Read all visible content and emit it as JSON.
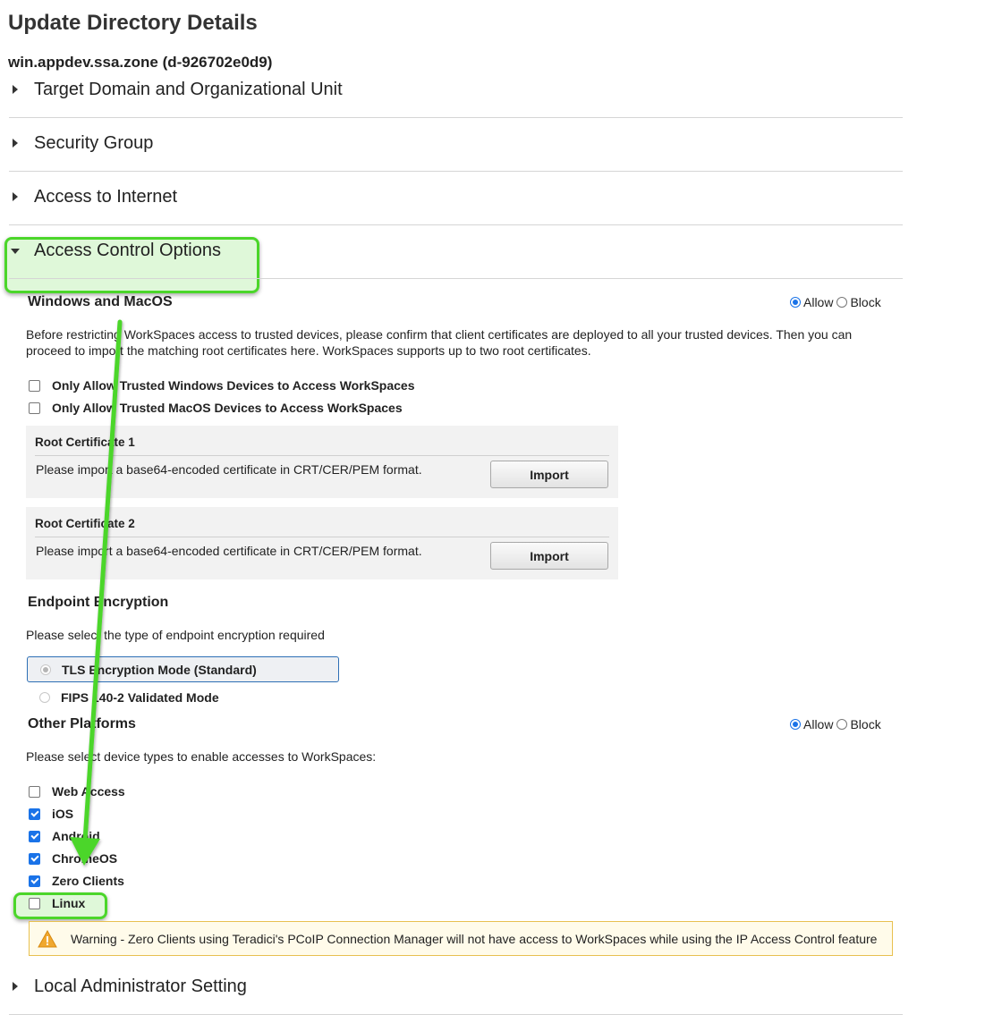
{
  "page_title": "Update Directory Details",
  "directory_id": "win.appdev.ssa.zone (d-926702e0d9)",
  "sections": [
    {
      "label": "Target Domain and Organizational Unit",
      "expanded": false
    },
    {
      "label": "Security Group",
      "expanded": false
    },
    {
      "label": "Access to Internet",
      "expanded": false
    },
    {
      "label": "Access Control Options",
      "expanded": true
    },
    {
      "label": "Local Administrator Setting",
      "expanded": false
    }
  ],
  "windows_macos": {
    "heading": "Windows and MacOS",
    "allow_label": "Allow",
    "block_label": "Block",
    "selected": "Allow",
    "description": "Before restricting WorkSpaces access to trusted devices, please confirm that client certificates are deployed to all your trusted devices. Then you can proceed to import the matching root certificates here. WorkSpaces supports up to two root certificates.",
    "options": [
      {
        "label": "Only Allow Trusted Windows Devices to Access WorkSpaces",
        "checked": false
      },
      {
        "label": "Only Allow Trusted MacOS Devices to Access WorkSpaces",
        "checked": false
      }
    ],
    "certificates": [
      {
        "title": "Root Certificate 1",
        "description": "Please import a base64-encoded certificate in CRT/CER/PEM format.",
        "button": "Import"
      },
      {
        "title": "Root Certificate 2",
        "description": "Please import a base64-encoded certificate in CRT/CER/PEM format.",
        "button": "Import"
      }
    ]
  },
  "endpoint_encryption": {
    "heading": "Endpoint Encryption",
    "description": "Please select the type of endpoint encryption required",
    "options": [
      {
        "label": "TLS Encryption Mode (Standard)",
        "selected": true
      },
      {
        "label": "FIPS 140-2 Validated Mode",
        "selected": false
      }
    ]
  },
  "other_platforms": {
    "heading": "Other Platforms",
    "allow_label": "Allow",
    "block_label": "Block",
    "selected": "Allow",
    "description": "Please select device types to enable accesses to WorkSpaces:",
    "devices": [
      {
        "label": "Web Access",
        "checked": false
      },
      {
        "label": "iOS",
        "checked": true
      },
      {
        "label": "Android",
        "checked": true
      },
      {
        "label": "ChromeOS",
        "checked": true
      },
      {
        "label": "Zero Clients",
        "checked": true
      },
      {
        "label": "Linux",
        "checked": false
      }
    ]
  },
  "warning": {
    "icon": "warning-triangle-icon",
    "text": "Warning - Zero Clients using Teradici's PCoIP Connection Manager will not have access to WorkSpaces while using the IP Access Control feature"
  },
  "colors": {
    "highlight": "#4bd62a",
    "accent": "#1a73e8",
    "warning_border": "#e8c050"
  }
}
